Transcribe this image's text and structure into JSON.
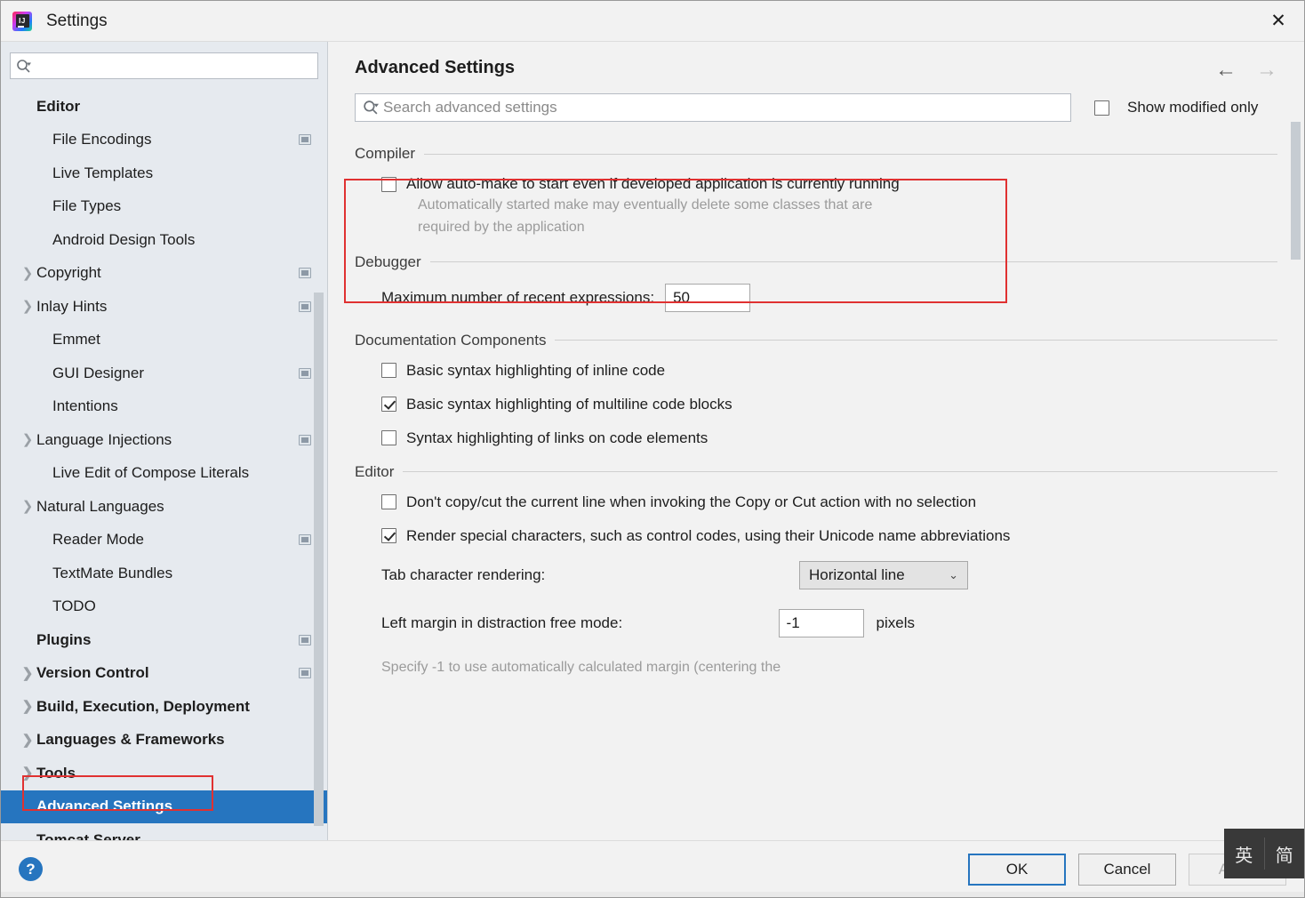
{
  "window": {
    "title": "Settings",
    "logo_text": "IJ",
    "close_icon": "✕"
  },
  "sidebar": {
    "search": {
      "placeholder": "",
      "value": "",
      "icon": "search-icon"
    },
    "items": [
      {
        "label": "Editor",
        "bold": true,
        "chevron": false,
        "indent": 0,
        "scope": false,
        "selected": false
      },
      {
        "label": "File Encodings",
        "bold": false,
        "chevron": false,
        "indent": 1,
        "scope": true,
        "selected": false
      },
      {
        "label": "Live Templates",
        "bold": false,
        "chevron": false,
        "indent": 1,
        "scope": false,
        "selected": false
      },
      {
        "label": "File Types",
        "bold": false,
        "chevron": false,
        "indent": 1,
        "scope": false,
        "selected": false
      },
      {
        "label": "Android Design Tools",
        "bold": false,
        "chevron": false,
        "indent": 1,
        "scope": false,
        "selected": false
      },
      {
        "label": "Copyright",
        "bold": false,
        "chevron": true,
        "indent": 0,
        "scope": true,
        "selected": false
      },
      {
        "label": "Inlay Hints",
        "bold": false,
        "chevron": true,
        "indent": 0,
        "scope": true,
        "selected": false
      },
      {
        "label": "Emmet",
        "bold": false,
        "chevron": false,
        "indent": 1,
        "scope": false,
        "selected": false
      },
      {
        "label": "GUI Designer",
        "bold": false,
        "chevron": false,
        "indent": 1,
        "scope": true,
        "selected": false
      },
      {
        "label": "Intentions",
        "bold": false,
        "chevron": false,
        "indent": 1,
        "scope": false,
        "selected": false
      },
      {
        "label": "Language Injections",
        "bold": false,
        "chevron": true,
        "indent": 0,
        "scope": true,
        "selected": false
      },
      {
        "label": "Live Edit of Compose Literals",
        "bold": false,
        "chevron": false,
        "indent": 1,
        "scope": false,
        "selected": false
      },
      {
        "label": "Natural Languages",
        "bold": false,
        "chevron": true,
        "indent": 0,
        "scope": false,
        "selected": false
      },
      {
        "label": "Reader Mode",
        "bold": false,
        "chevron": false,
        "indent": 1,
        "scope": true,
        "selected": false
      },
      {
        "label": "TextMate Bundles",
        "bold": false,
        "chevron": false,
        "indent": 1,
        "scope": false,
        "selected": false
      },
      {
        "label": "TODO",
        "bold": false,
        "chevron": false,
        "indent": 1,
        "scope": false,
        "selected": false
      },
      {
        "label": "Plugins",
        "bold": true,
        "chevron": false,
        "indent": 0,
        "scope": true,
        "selected": false
      },
      {
        "label": "Version Control",
        "bold": true,
        "chevron": true,
        "indent": 0,
        "scope": true,
        "selected": false
      },
      {
        "label": "Build, Execution, Deployment",
        "bold": true,
        "chevron": true,
        "indent": 0,
        "scope": false,
        "selected": false
      },
      {
        "label": "Languages & Frameworks",
        "bold": true,
        "chevron": true,
        "indent": 0,
        "scope": false,
        "selected": false
      },
      {
        "label": "Tools",
        "bold": true,
        "chevron": true,
        "indent": 0,
        "scope": false,
        "selected": false
      },
      {
        "label": "Advanced Settings",
        "bold": true,
        "chevron": false,
        "indent": 0,
        "scope": false,
        "selected": true
      },
      {
        "label": "Tomcat Server",
        "bold": true,
        "chevron": false,
        "indent": 0,
        "scope": false,
        "selected": false
      }
    ]
  },
  "main": {
    "page_title": "Advanced Settings",
    "nav": {
      "back_icon": "←",
      "forward_icon": "→"
    },
    "search": {
      "placeholder": "Search advanced settings",
      "value": "",
      "icon": "search-icon"
    },
    "show_modified_only": {
      "label": "Show modified only",
      "checked": false
    },
    "sections": [
      {
        "name": "Compiler",
        "options": [
          {
            "type": "checkbox",
            "label": "Allow auto-make to start even if developed application is currently running",
            "checked": false,
            "hint": "Automatically started make may eventually delete some classes that are required by the application"
          }
        ]
      },
      {
        "name": "Debugger",
        "options": [
          {
            "type": "text",
            "label": "Maximum number of recent expressions:",
            "value": "50"
          }
        ]
      },
      {
        "name": "Documentation Components",
        "options": [
          {
            "type": "checkbox",
            "label": "Basic syntax highlighting of inline code",
            "checked": false
          },
          {
            "type": "checkbox",
            "label": "Basic syntax highlighting of multiline code blocks",
            "checked": true
          },
          {
            "type": "checkbox",
            "label": "Syntax highlighting of links on code elements",
            "checked": false
          }
        ]
      },
      {
        "name": "Editor",
        "options": [
          {
            "type": "checkbox",
            "label": "Don't copy/cut the current line when invoking the Copy or Cut action with no selection",
            "checked": false
          },
          {
            "type": "checkbox",
            "label": "Render special characters, such as control codes, using their Unicode name abbreviations",
            "checked": true
          },
          {
            "type": "combo",
            "label": "Tab character rendering:",
            "value": "Horizontal line",
            "caret": "⌄"
          },
          {
            "type": "text",
            "label": "Left margin in distraction free mode:",
            "value": "-1",
            "suffix": "pixels"
          }
        ],
        "trailing_hint": "Specify -1 to use automatically calculated margin (centering the"
      }
    ]
  },
  "footer": {
    "help_label": "?",
    "ok_label": "OK",
    "cancel_label": "Cancel",
    "apply_label": "Apply"
  },
  "ime_overlay": {
    "key1": "英",
    "key2": "简"
  },
  "colors": {
    "accent": "#2675bf",
    "annotation": "#e03131",
    "sidebar_bg": "#e6eaef",
    "content_bg": "#f2f2f2"
  }
}
